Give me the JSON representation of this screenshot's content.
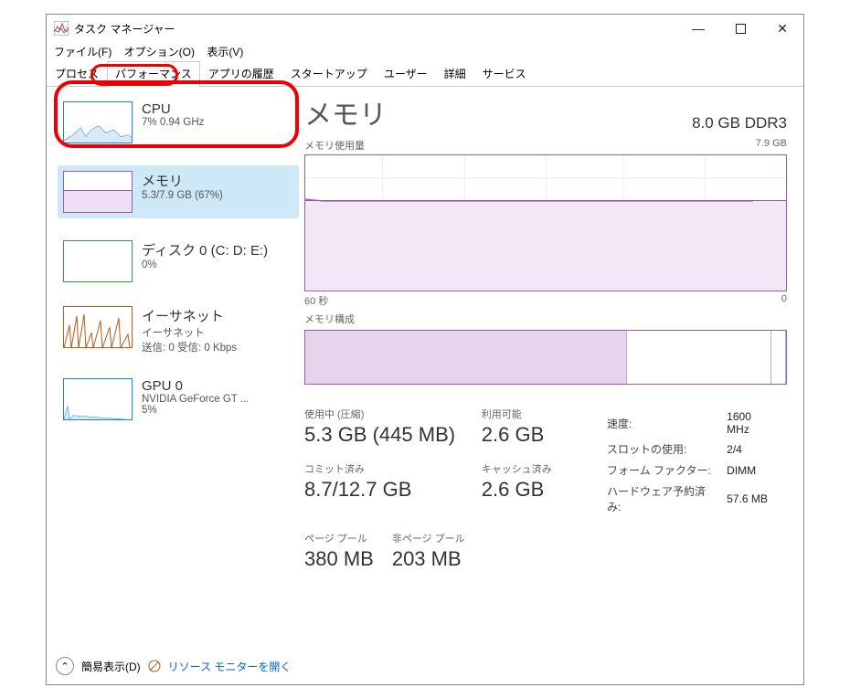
{
  "window": {
    "title": "タスク マネージャー"
  },
  "menu": {
    "file": "ファイル(F)",
    "options": "オプション(O)",
    "view": "表示(V)"
  },
  "tabs": [
    "プロセス",
    "パフォーマンス",
    "アプリの履歴",
    "スタートアップ",
    "ユーザー",
    "詳細",
    "サービス"
  ],
  "sidebar": {
    "items": [
      {
        "title": "CPU",
        "sub": "7% 0.94 GHz",
        "color": "#1a84d6"
      },
      {
        "title": "メモリ",
        "sub": "5.3/7.9 GB (67%)",
        "color": "#9b59b6"
      },
      {
        "title": "ディスク 0 (C: D: E:)",
        "sub": "0%",
        "color": "#2e9c4a"
      },
      {
        "title": "イーサネット",
        "sub": "イーサネット",
        "sub2": "送信: 0 受信: 0 Kbps",
        "color": "#b85c18"
      },
      {
        "title": "GPU 0",
        "sub": "NVIDIA GeForce GT ...",
        "sub2": "5%",
        "color": "#1a84d6"
      }
    ]
  },
  "main": {
    "title": "メモリ",
    "total": "8.0 GB DDR3",
    "usage_label": "メモリ使用量",
    "usage_max": "7.9 GB",
    "x_left": "60 秒",
    "x_right": "0",
    "comp_label": "メモリ構成"
  },
  "stats": {
    "in_use_label": "使用中 (圧縮)",
    "in_use": "5.3 GB (445 MB)",
    "available_label": "利用可能",
    "available": "2.6 GB",
    "committed_label": "コミット済み",
    "committed": "8.7/12.7 GB",
    "cached_label": "キャッシュ済み",
    "cached": "2.6 GB",
    "paged_label": "ページ プール",
    "paged": "380 MB",
    "nonpaged_label": "非ページ プール",
    "nonpaged": "203 MB",
    "speed_label": "速度:",
    "speed": "1600 MHz",
    "slots_label": "スロットの使用:",
    "slots": "2/4",
    "form_label": "フォーム ファクター:",
    "form": "DIMM",
    "reserved_label": "ハードウェア予約済み:",
    "reserved": "57.6 MB"
  },
  "footer": {
    "fewer": "簡易表示(D)",
    "resmon": "リソース モニターを開く"
  },
  "chart_data": {
    "type": "area",
    "title": "メモリ使用量",
    "ylabel": "GB",
    "ylim": [
      0,
      7.9
    ],
    "xlabel": "秒",
    "xlim": [
      60,
      0
    ],
    "series": [
      {
        "name": "使用中",
        "values": [
          5.3,
          5.3,
          5.3,
          5.3,
          5.3,
          5.3,
          5.3,
          5.3,
          5.3,
          5.3,
          5.3,
          5.3
        ]
      }
    ],
    "composition": {
      "in_use_gb": 5.3,
      "modified_gb": 0.0,
      "standby_gb": 2.6,
      "free_gb": 0.0,
      "reserved_gb": 0.1
    }
  }
}
